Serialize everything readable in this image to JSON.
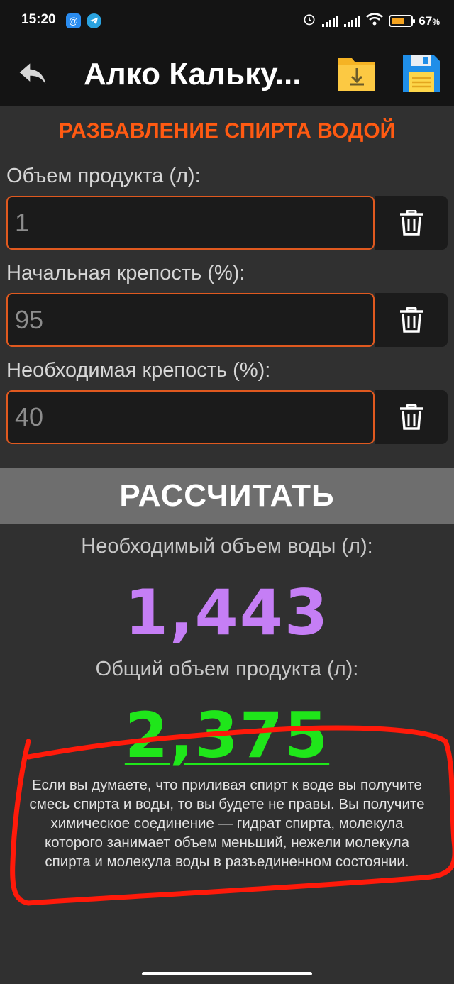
{
  "status": {
    "time": "15:20",
    "battery": "67",
    "battery_unit": "%",
    "battery_level": 0.67
  },
  "app_bar": {
    "title": "Алко Кальку..."
  },
  "section": {
    "title": "РАЗБАВЛЕНИЕ СПИРТА ВОДОЙ"
  },
  "fields": [
    {
      "label": "Объем продукта (л):",
      "value": "1"
    },
    {
      "label": "Начальная крепость (%):",
      "value": "95"
    },
    {
      "label": "Необходимая крепость (%):",
      "value": "40"
    }
  ],
  "calculate_label": "РАССЧИТАТЬ",
  "results": {
    "water_label": "Необходимый объем воды (л):",
    "water_value": "1,443",
    "total_label": "Общий объем продукта (л):",
    "total_value": "2,375"
  },
  "info_lines": [
    "Если вы думаете, что приливая спирт к воде вы получите",
    "смесь спирта и воды, то вы будете не правы. Вы получите",
    "химическое соединение — гидрат спирта, молекула",
    "которого занимает объем меньший, нежели молекула",
    "спирта и молекула воды в разъединенном состоянии."
  ],
  "colors": {
    "accent": "#ff5a12",
    "water_value": "#c57ef5",
    "total_value": "#1fe61a",
    "annotation": "#ff1a0a"
  }
}
